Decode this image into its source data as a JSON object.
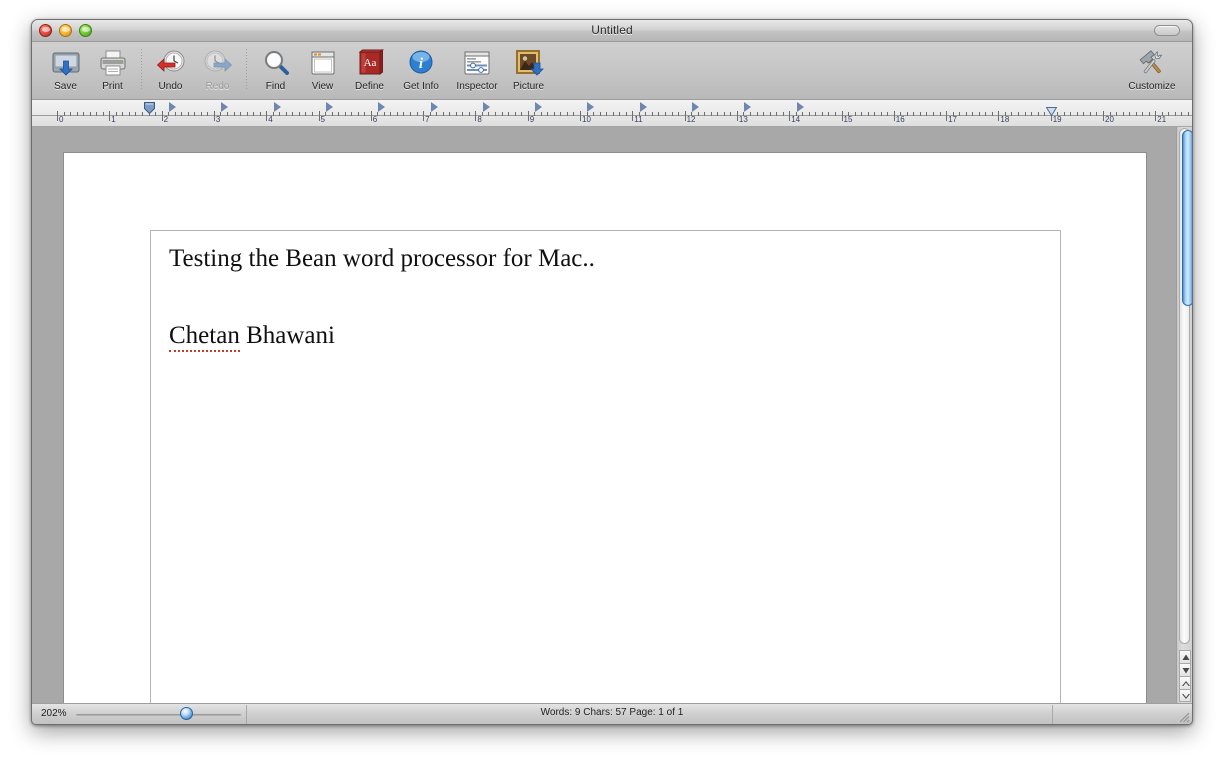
{
  "window": {
    "title": "Untitled",
    "traffic_lights": [
      "close-button",
      "minimize-button",
      "zoom-button"
    ]
  },
  "toolbar": {
    "items": [
      {
        "id": "save",
        "label": "Save",
        "icon": "save-icon",
        "enabled": true
      },
      {
        "id": "print",
        "label": "Print",
        "icon": "print-icon",
        "enabled": true
      },
      {
        "id": "undo",
        "label": "Undo",
        "icon": "undo-icon",
        "enabled": true
      },
      {
        "id": "redo",
        "label": "Redo",
        "icon": "redo-icon",
        "enabled": false
      },
      {
        "id": "find",
        "label": "Find",
        "icon": "find-icon",
        "enabled": true
      },
      {
        "id": "view",
        "label": "View",
        "icon": "view-icon",
        "enabled": true
      },
      {
        "id": "define",
        "label": "Define",
        "icon": "define-icon",
        "enabled": true
      },
      {
        "id": "getinfo",
        "label": "Get Info",
        "icon": "info-icon",
        "enabled": true
      },
      {
        "id": "inspector",
        "label": "Inspector",
        "icon": "inspector-icon",
        "enabled": true
      },
      {
        "id": "picture",
        "label": "Picture",
        "icon": "picture-icon",
        "enabled": true
      }
    ],
    "customize": {
      "label": "Customize",
      "icon": "hammer-wrench-icon"
    }
  },
  "ruler": {
    "unit": "inch",
    "numbers": [
      0,
      1,
      2,
      3,
      4,
      5,
      6,
      7,
      8,
      9,
      10,
      11,
      12,
      13,
      14,
      15,
      16,
      17,
      18,
      19,
      20,
      21
    ],
    "tab_stops_inches": [
      2.2,
      3.2,
      4.2,
      5.2,
      6.2,
      7.2,
      8.2,
      9.2,
      10.2,
      11.2,
      12.2,
      13.2,
      14.2
    ],
    "left_indent_inch": 1.75,
    "right_indent_inch": 19.0
  },
  "document": {
    "lines": [
      {
        "text": "Testing the Bean word processor for Mac..",
        "misspelled": ""
      },
      {
        "text": "Chetan Bhawani",
        "misspelled": "Chetan"
      }
    ],
    "line1_text": "Testing the Bean word processor for Mac..",
    "line2_misspelled": "Chetan",
    "line2_rest": " Bhawani"
  },
  "status": {
    "zoom": "202%",
    "info": "Words: 9  Chars: 57  Page: 1 of 1",
    "words": 9,
    "chars": 57,
    "page_current": 1,
    "page_total": 1
  },
  "colors": {
    "accent": "#4c8fd4",
    "spellcheck": "#c43b28",
    "toolbar_bg": "#c6c6c6",
    "page_bg": "#ffffff",
    "canvas_bg": "#a8a8a8"
  }
}
